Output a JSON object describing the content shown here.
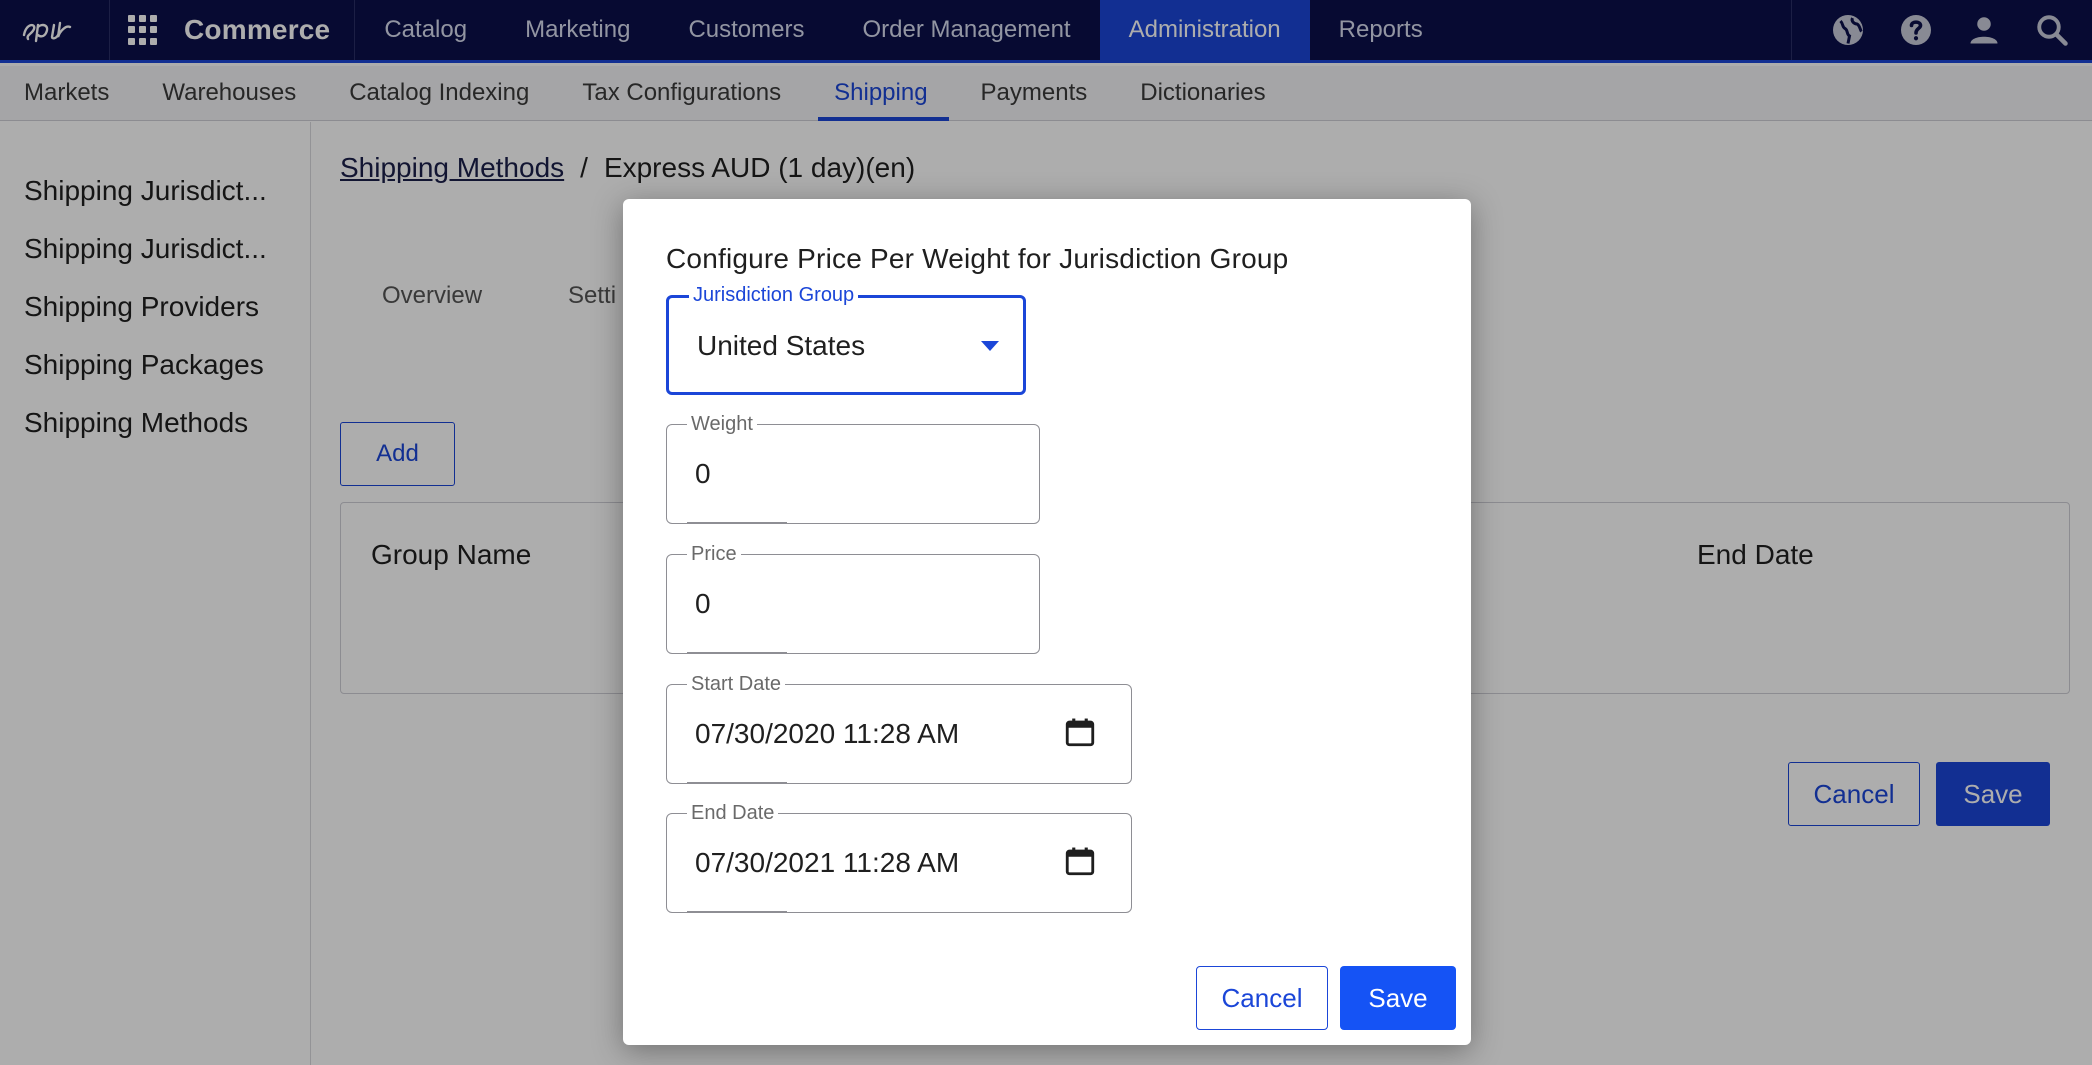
{
  "header": {
    "logo_icon": "epi-logo-icon",
    "apps_icon": "apps-grid-icon",
    "brand": "Commerce",
    "nav": [
      {
        "label": "Catalog"
      },
      {
        "label": "Marketing"
      },
      {
        "label": "Customers"
      },
      {
        "label": "Order Management"
      },
      {
        "label": "Administration",
        "active": true
      },
      {
        "label": "Reports"
      }
    ],
    "icons": [
      "globe-icon",
      "help-icon",
      "user-icon",
      "search-icon"
    ]
  },
  "subnav": {
    "items": [
      {
        "label": "Markets"
      },
      {
        "label": "Warehouses"
      },
      {
        "label": "Catalog Indexing"
      },
      {
        "label": "Tax Configurations"
      },
      {
        "label": "Shipping",
        "active": true
      },
      {
        "label": "Payments"
      },
      {
        "label": "Dictionaries"
      }
    ]
  },
  "sidebar": {
    "items": [
      {
        "label": "Shipping Jurisdict..."
      },
      {
        "label": "Shipping Jurisdict..."
      },
      {
        "label": "Shipping Providers"
      },
      {
        "label": "Shipping Packages"
      },
      {
        "label": "Shipping Methods"
      }
    ]
  },
  "main": {
    "breadcrumb": {
      "link": "Shipping Methods",
      "separator": "/",
      "current": "Express AUD (1 day)(en)"
    },
    "tabs": [
      {
        "label": "Overview"
      },
      {
        "label": "Setti"
      }
    ],
    "add_label": "Add",
    "table": {
      "columns": [
        "Group Name",
        "End Date"
      ]
    },
    "cancel_label": "Cancel",
    "save_label": "Save"
  },
  "modal": {
    "title": "Configure Price Per Weight for Jurisdiction Group",
    "jurisdiction_group": {
      "label": "Jurisdiction Group",
      "value": "United States"
    },
    "weight": {
      "label": "Weight",
      "value": "0"
    },
    "price": {
      "label": "Price",
      "value": "0"
    },
    "start_date": {
      "label": "Start Date",
      "value": "07/30/2020 11:28 AM"
    },
    "end_date": {
      "label": "End Date",
      "value": "07/30/2021 11:28 AM"
    },
    "cancel_label": "Cancel",
    "save_label": "Save"
  },
  "colors": {
    "header_bg": "#0b0f4a",
    "accent": "#1b46d8",
    "primary_button": "#1553f5"
  }
}
